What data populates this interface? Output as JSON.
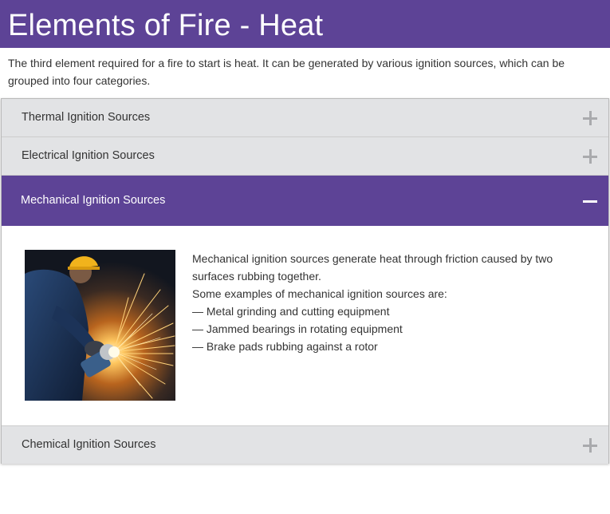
{
  "page": {
    "title": "Elements of Fire - Heat",
    "intro": "The third element required for a fire to start is heat. It can be generated by various ignition sources, which can be grouped into four categories."
  },
  "accordion": {
    "sections": [
      {
        "label": "Thermal Ignition Sources",
        "expanded": false
      },
      {
        "label": "Electrical Ignition Sources",
        "expanded": false
      },
      {
        "label": "Mechanical Ignition Sources",
        "expanded": true
      },
      {
        "label": "Chemical Ignition Sources",
        "expanded": false
      }
    ],
    "active_panel": {
      "description": "Mechanical ignition sources generate heat through friction caused by two surfaces rubbing together.",
      "examples_intro": "Some examples of mechanical ignition sources are:",
      "examples": [
        "— Metal grinding and cutting equipment",
        "— Jammed bearings in rotating equipment",
        "— Brake pads rubbing against a rotor"
      ]
    }
  },
  "colors": {
    "brand_purple": "#5d4396",
    "header_gray": "#e2e3e5",
    "icon_gray": "#a9aaad",
    "text": "#333333"
  },
  "icons": {
    "collapsed": "plus-icon",
    "expanded": "minus-icon"
  }
}
